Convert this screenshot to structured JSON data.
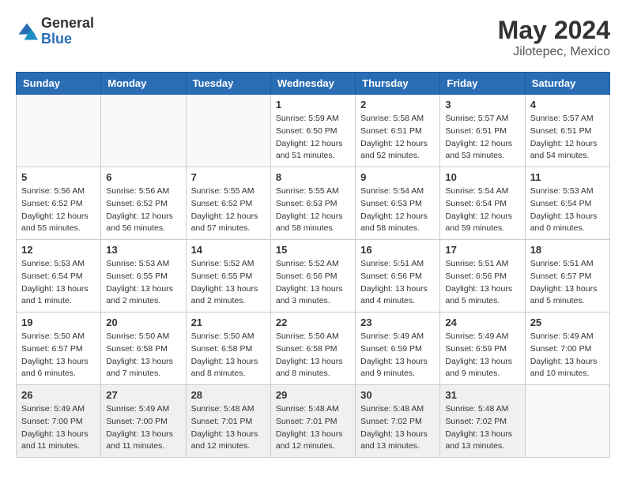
{
  "header": {
    "logo_general": "General",
    "logo_blue": "Blue",
    "month_year": "May 2024",
    "location": "Jilotepec, Mexico"
  },
  "weekdays": [
    "Sunday",
    "Monday",
    "Tuesday",
    "Wednesday",
    "Thursday",
    "Friday",
    "Saturday"
  ],
  "weeks": [
    [
      {
        "day": "",
        "info": ""
      },
      {
        "day": "",
        "info": ""
      },
      {
        "day": "",
        "info": ""
      },
      {
        "day": "1",
        "info": "Sunrise: 5:59 AM\nSunset: 6:50 PM\nDaylight: 12 hours\nand 51 minutes."
      },
      {
        "day": "2",
        "info": "Sunrise: 5:58 AM\nSunset: 6:51 PM\nDaylight: 12 hours\nand 52 minutes."
      },
      {
        "day": "3",
        "info": "Sunrise: 5:57 AM\nSunset: 6:51 PM\nDaylight: 12 hours\nand 53 minutes."
      },
      {
        "day": "4",
        "info": "Sunrise: 5:57 AM\nSunset: 6:51 PM\nDaylight: 12 hours\nand 54 minutes."
      }
    ],
    [
      {
        "day": "5",
        "info": "Sunrise: 5:56 AM\nSunset: 6:52 PM\nDaylight: 12 hours\nand 55 minutes."
      },
      {
        "day": "6",
        "info": "Sunrise: 5:56 AM\nSunset: 6:52 PM\nDaylight: 12 hours\nand 56 minutes."
      },
      {
        "day": "7",
        "info": "Sunrise: 5:55 AM\nSunset: 6:52 PM\nDaylight: 12 hours\nand 57 minutes."
      },
      {
        "day": "8",
        "info": "Sunrise: 5:55 AM\nSunset: 6:53 PM\nDaylight: 12 hours\nand 58 minutes."
      },
      {
        "day": "9",
        "info": "Sunrise: 5:54 AM\nSunset: 6:53 PM\nDaylight: 12 hours\nand 58 minutes."
      },
      {
        "day": "10",
        "info": "Sunrise: 5:54 AM\nSunset: 6:54 PM\nDaylight: 12 hours\nand 59 minutes."
      },
      {
        "day": "11",
        "info": "Sunrise: 5:53 AM\nSunset: 6:54 PM\nDaylight: 13 hours\nand 0 minutes."
      }
    ],
    [
      {
        "day": "12",
        "info": "Sunrise: 5:53 AM\nSunset: 6:54 PM\nDaylight: 13 hours\nand 1 minute."
      },
      {
        "day": "13",
        "info": "Sunrise: 5:53 AM\nSunset: 6:55 PM\nDaylight: 13 hours\nand 2 minutes."
      },
      {
        "day": "14",
        "info": "Sunrise: 5:52 AM\nSunset: 6:55 PM\nDaylight: 13 hours\nand 2 minutes."
      },
      {
        "day": "15",
        "info": "Sunrise: 5:52 AM\nSunset: 6:56 PM\nDaylight: 13 hours\nand 3 minutes."
      },
      {
        "day": "16",
        "info": "Sunrise: 5:51 AM\nSunset: 6:56 PM\nDaylight: 13 hours\nand 4 minutes."
      },
      {
        "day": "17",
        "info": "Sunrise: 5:51 AM\nSunset: 6:56 PM\nDaylight: 13 hours\nand 5 minutes."
      },
      {
        "day": "18",
        "info": "Sunrise: 5:51 AM\nSunset: 6:57 PM\nDaylight: 13 hours\nand 5 minutes."
      }
    ],
    [
      {
        "day": "19",
        "info": "Sunrise: 5:50 AM\nSunset: 6:57 PM\nDaylight: 13 hours\nand 6 minutes."
      },
      {
        "day": "20",
        "info": "Sunrise: 5:50 AM\nSunset: 6:58 PM\nDaylight: 13 hours\nand 7 minutes."
      },
      {
        "day": "21",
        "info": "Sunrise: 5:50 AM\nSunset: 6:58 PM\nDaylight: 13 hours\nand 8 minutes."
      },
      {
        "day": "22",
        "info": "Sunrise: 5:50 AM\nSunset: 6:58 PM\nDaylight: 13 hours\nand 8 minutes."
      },
      {
        "day": "23",
        "info": "Sunrise: 5:49 AM\nSunset: 6:59 PM\nDaylight: 13 hours\nand 9 minutes."
      },
      {
        "day": "24",
        "info": "Sunrise: 5:49 AM\nSunset: 6:59 PM\nDaylight: 13 hours\nand 9 minutes."
      },
      {
        "day": "25",
        "info": "Sunrise: 5:49 AM\nSunset: 7:00 PM\nDaylight: 13 hours\nand 10 minutes."
      }
    ],
    [
      {
        "day": "26",
        "info": "Sunrise: 5:49 AM\nSunset: 7:00 PM\nDaylight: 13 hours\nand 11 minutes."
      },
      {
        "day": "27",
        "info": "Sunrise: 5:49 AM\nSunset: 7:00 PM\nDaylight: 13 hours\nand 11 minutes."
      },
      {
        "day": "28",
        "info": "Sunrise: 5:48 AM\nSunset: 7:01 PM\nDaylight: 13 hours\nand 12 minutes."
      },
      {
        "day": "29",
        "info": "Sunrise: 5:48 AM\nSunset: 7:01 PM\nDaylight: 13 hours\nand 12 minutes."
      },
      {
        "day": "30",
        "info": "Sunrise: 5:48 AM\nSunset: 7:02 PM\nDaylight: 13 hours\nand 13 minutes."
      },
      {
        "day": "31",
        "info": "Sunrise: 5:48 AM\nSunset: 7:02 PM\nDaylight: 13 hours\nand 13 minutes."
      },
      {
        "day": "",
        "info": ""
      }
    ]
  ]
}
